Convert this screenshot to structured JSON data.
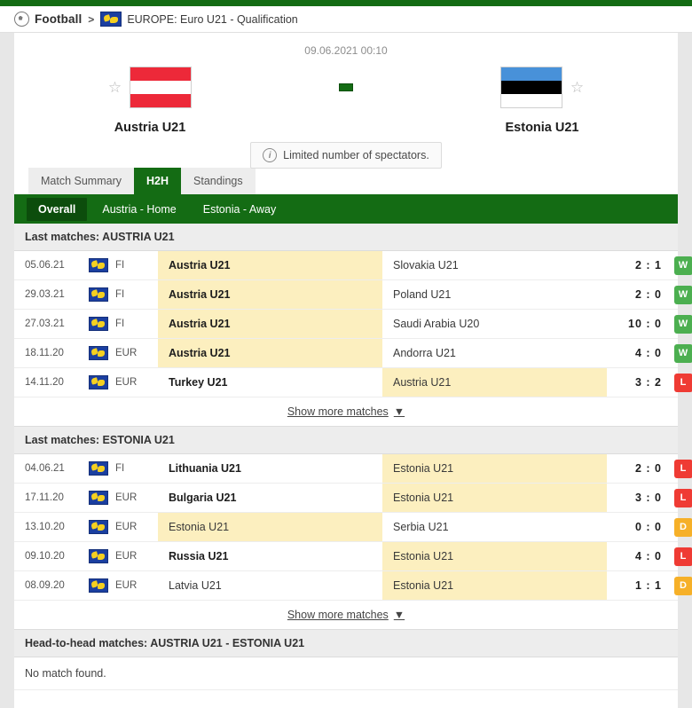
{
  "breadcrumb": {
    "sport": "Football",
    "separator": ">",
    "league": "EUROPE: Euro U21 - Qualification",
    "sport_icon": "football-ball-icon",
    "league_flag": "europe-flag-icon"
  },
  "match": {
    "kickoff": "09.06.2021 00:10",
    "home_team": "Austria U21",
    "away_team": "Estonia U21",
    "score_separator": "-",
    "notice": "Limited number of spectators.",
    "notice_icon": "info-circle-icon",
    "favourite_icon": "star-outline-icon",
    "home_flag": "austria-flag",
    "away_flag": "estonia-flag"
  },
  "tabs": [
    {
      "label": "Match Summary",
      "active": false
    },
    {
      "label": "H2H",
      "active": true
    },
    {
      "label": "Standings",
      "active": false
    }
  ],
  "subtabs": [
    {
      "label": "Overall",
      "active": true
    },
    {
      "label": "Austria - Home",
      "active": false
    },
    {
      "label": "Estonia - Away",
      "active": false
    }
  ],
  "sections": [
    {
      "title": "Last matches: AUSTRIA U21",
      "rows": [
        {
          "date": "05.06.21",
          "flag": "europe-flag-icon",
          "comp": "FI",
          "home": "Austria U21",
          "away": "Slovakia U21",
          "home_bold": true,
          "away_bold": false,
          "home_hl": true,
          "away_hl": false,
          "score": "2 : 1",
          "result": "W"
        },
        {
          "date": "29.03.21",
          "flag": "europe-flag-icon",
          "comp": "FI",
          "home": "Austria U21",
          "away": "Poland U21",
          "home_bold": true,
          "away_bold": false,
          "home_hl": true,
          "away_hl": false,
          "score": "2 : 0",
          "result": "W"
        },
        {
          "date": "27.03.21",
          "flag": "europe-flag-icon",
          "comp": "FI",
          "home": "Austria U21",
          "away": "Saudi Arabia U20",
          "home_bold": true,
          "away_bold": false,
          "home_hl": true,
          "away_hl": false,
          "score": "10 : 0",
          "result": "W"
        },
        {
          "date": "18.11.20",
          "flag": "europe-flag-icon",
          "comp": "EUR",
          "home": "Austria U21",
          "away": "Andorra U21",
          "home_bold": true,
          "away_bold": false,
          "home_hl": true,
          "away_hl": false,
          "score": "4 : 0",
          "result": "W"
        },
        {
          "date": "14.11.20",
          "flag": "europe-flag-icon",
          "comp": "EUR",
          "home": "Turkey U21",
          "away": "Austria U21",
          "home_bold": true,
          "away_bold": false,
          "home_hl": false,
          "away_hl": true,
          "score": "3 : 2",
          "result": "L"
        }
      ],
      "show_more": "Show more matches"
    },
    {
      "title": "Last matches: ESTONIA U21",
      "rows": [
        {
          "date": "04.06.21",
          "flag": "europe-flag-icon",
          "comp": "FI",
          "home": "Lithuania U21",
          "away": "Estonia U21",
          "home_bold": true,
          "away_bold": false,
          "home_hl": false,
          "away_hl": true,
          "score": "2 : 0",
          "result": "L"
        },
        {
          "date": "17.11.20",
          "flag": "europe-flag-icon",
          "comp": "EUR",
          "home": "Bulgaria U21",
          "away": "Estonia U21",
          "home_bold": true,
          "away_bold": false,
          "home_hl": false,
          "away_hl": true,
          "score": "3 : 0",
          "result": "L"
        },
        {
          "date": "13.10.20",
          "flag": "europe-flag-icon",
          "comp": "EUR",
          "home": "Estonia U21",
          "away": "Serbia U21",
          "home_bold": false,
          "away_bold": false,
          "home_hl": true,
          "away_hl": false,
          "score": "0 : 0",
          "result": "D"
        },
        {
          "date": "09.10.20",
          "flag": "europe-flag-icon",
          "comp": "EUR",
          "home": "Russia U21",
          "away": "Estonia U21",
          "home_bold": true,
          "away_bold": false,
          "home_hl": false,
          "away_hl": true,
          "score": "4 : 0",
          "result": "L"
        },
        {
          "date": "08.09.20",
          "flag": "europe-flag-icon",
          "comp": "EUR",
          "home": "Latvia U21",
          "away": "Estonia U21",
          "home_bold": false,
          "away_bold": false,
          "home_hl": false,
          "away_hl": true,
          "score": "1 : 1",
          "result": "D"
        }
      ],
      "show_more": "Show more matches"
    }
  ],
  "h2h": {
    "title": "Head-to-head matches: AUSTRIA U21 - ESTONIA U21",
    "empty_text": "No match found."
  },
  "colors": {
    "brand_green": "#146c14",
    "highlight_yellow": "#fcefbf",
    "win": "#4caf50",
    "loss": "#ef3b34",
    "draw": "#f6b028"
  }
}
